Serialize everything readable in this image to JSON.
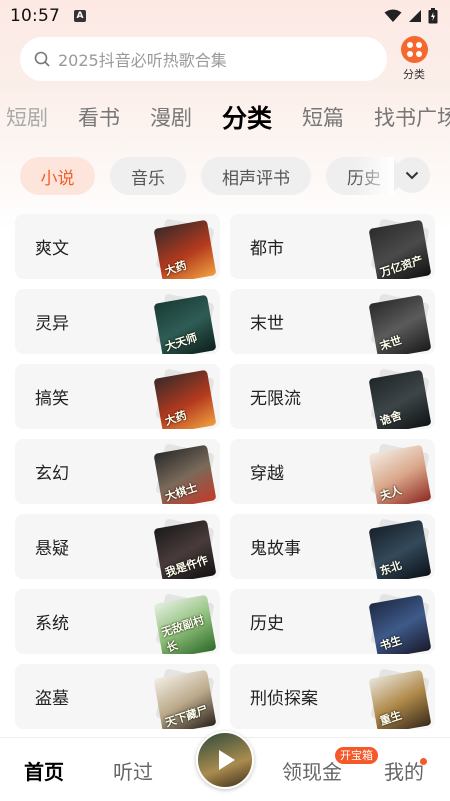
{
  "status": {
    "time": "10:57",
    "notif": "A"
  },
  "search": {
    "placeholder": "2025抖音必听热歌合集"
  },
  "category_button": {
    "label": "分类"
  },
  "tabs": [
    {
      "label": "短剧"
    },
    {
      "label": "看书"
    },
    {
      "label": "漫剧"
    },
    {
      "label": "分类"
    },
    {
      "label": "短篇"
    },
    {
      "label": "找书广场"
    }
  ],
  "active_tab": "分类",
  "chips": [
    {
      "label": "小说"
    },
    {
      "label": "音乐"
    },
    {
      "label": "相声评书"
    },
    {
      "label": "历史"
    }
  ],
  "categories": [
    {
      "label": "爽文",
      "cover_text": "大药"
    },
    {
      "label": "都市",
      "cover_text": "万亿资产"
    },
    {
      "label": "灵异",
      "cover_text": "大天师"
    },
    {
      "label": "末世",
      "cover_text": "末世"
    },
    {
      "label": "搞笑",
      "cover_text": "大药"
    },
    {
      "label": "无限流",
      "cover_text": "诡舍"
    },
    {
      "label": "玄幻",
      "cover_text": "大棋士"
    },
    {
      "label": "穿越",
      "cover_text": "夫人"
    },
    {
      "label": "悬疑",
      "cover_text": "我是仵作"
    },
    {
      "label": "鬼故事",
      "cover_text": "东北"
    },
    {
      "label": "系统",
      "cover_text": "无敌副村长"
    },
    {
      "label": "历史",
      "cover_text": "书生"
    },
    {
      "label": "盗墓",
      "cover_text": "天下藏尸"
    },
    {
      "label": "刑侦探案",
      "cover_text": "重生"
    }
  ],
  "colors": {
    "accent": "#f3602a",
    "tile_bg": "#f6f6f6"
  },
  "bottom_nav": {
    "home": "首页",
    "listened": "听过",
    "earn": "领现金",
    "earn_badge": "开宝箱",
    "mine": "我的"
  }
}
